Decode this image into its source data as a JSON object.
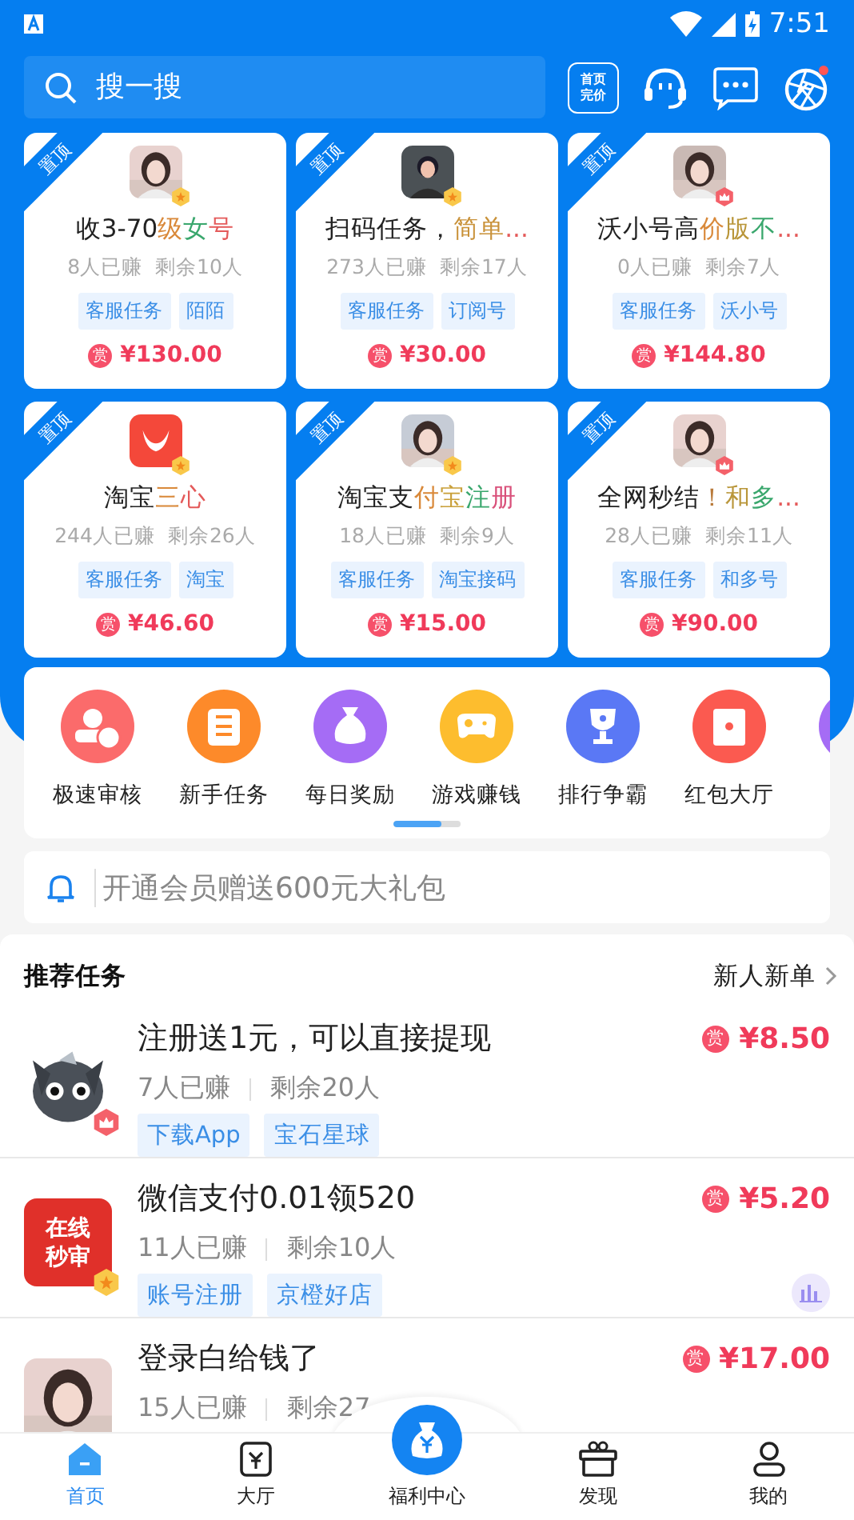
{
  "status_bar": {
    "time": "7:51"
  },
  "search": {
    "placeholder": "搜一搜"
  },
  "header_badge": [
    "首页",
    "完价"
  ],
  "cards": [
    {
      "pinned_label": "置顶",
      "title": [
        {
          "text": "收3-70"
        },
        {
          "text": "级",
          "color": "#d9893a"
        },
        {
          "text": "女",
          "color": "#3aa76d"
        },
        {
          "text": "号",
          "color": "#e45a5a"
        }
      ],
      "earned": "8人已赚",
      "remaining": "剩余10人",
      "tags": [
        "客服任务",
        "陌陌"
      ],
      "reward_mark": "赏",
      "price": "¥130.00"
    },
    {
      "pinned_label": "置顶",
      "title": [
        {
          "text": "扫码任务，"
        },
        {
          "text": "简单",
          "color": "#c9923a"
        },
        {
          "text": "...",
          "color": "#e45a5a"
        }
      ],
      "earned": "273人已赚",
      "remaining": "剩余17人",
      "tags": [
        "客服任务",
        "订阅号"
      ],
      "reward_mark": "赏",
      "price": "¥30.00"
    },
    {
      "pinned_label": "置顶",
      "title": [
        {
          "text": "沃小号高"
        },
        {
          "text": "价",
          "color": "#d9893a"
        },
        {
          "text": "版",
          "color": "#b9963a"
        },
        {
          "text": "不",
          "color": "#3aa76d"
        },
        {
          "text": "...",
          "color": "#e45a5a"
        }
      ],
      "earned": "0人已赚",
      "remaining": "剩余7人",
      "tags": [
        "客服任务",
        "沃小号"
      ],
      "reward_mark": "赏",
      "price": "¥144.80"
    },
    {
      "pinned_label": "置顶",
      "title": [
        {
          "text": "淘宝"
        },
        {
          "text": "三",
          "color": "#d9893a"
        },
        {
          "text": "心",
          "color": "#e45a5a"
        }
      ],
      "earned": "244人已赚",
      "remaining": "剩余26人",
      "tags": [
        "客服任务",
        "淘宝"
      ],
      "reward_mark": "赏",
      "price": "¥46.60"
    },
    {
      "pinned_label": "置顶",
      "title": [
        {
          "text": "淘宝支"
        },
        {
          "text": "付",
          "color": "#d9893a"
        },
        {
          "text": "宝",
          "color": "#c9a03a"
        },
        {
          "text": "注",
          "color": "#3aa76d"
        },
        {
          "text": "册",
          "color": "#d9507a"
        }
      ],
      "earned": "18人已赚",
      "remaining": "剩余9人",
      "tags": [
        "客服任务",
        "淘宝接码"
      ],
      "reward_mark": "赏",
      "price": "¥15.00"
    },
    {
      "pinned_label": "置顶",
      "title": [
        {
          "text": "全网秒结"
        },
        {
          "text": "！",
          "color": "#b97a3a"
        },
        {
          "text": "和",
          "color": "#b9963a"
        },
        {
          "text": "多",
          "color": "#3aa76d"
        },
        {
          "text": "...",
          "color": "#e45a5a"
        }
      ],
      "earned": "28人已赚",
      "remaining": "剩余11人",
      "tags": [
        "客服任务",
        "和多号"
      ],
      "reward_mark": "赏",
      "price": "¥90.00"
    }
  ],
  "shortcuts": [
    {
      "label": "极速审核",
      "color": "#fb6b6b"
    },
    {
      "label": "新手任务",
      "color": "#fd8a2a"
    },
    {
      "label": "每日奖励",
      "color": "#a56cf5"
    },
    {
      "label": "游戏赚钱",
      "color": "#fdbd2e"
    },
    {
      "label": "排行争霸",
      "color": "#5a78f5"
    },
    {
      "label": "红包大厅",
      "color": "#fb5a50"
    },
    {
      "color": "#a56cf5"
    }
  ],
  "notice": "开通会员赠送600元大礼包",
  "recommended": {
    "title": "推荐任务",
    "link": "新人新单"
  },
  "tasks": [
    {
      "title": "注册送1元，可以直接提现",
      "earned": "7人已赚",
      "remaining": "剩余20人",
      "tags": [
        "下载App",
        "宝石星球"
      ],
      "reward_mark": "赏",
      "price": "¥8.50"
    },
    {
      "title": "微信支付0.01领520",
      "avatar_text": [
        "在线",
        "秒审"
      ],
      "earned": "11人已赚",
      "remaining": "剩余10人",
      "tags": [
        "账号注册",
        "京橙好店"
      ],
      "reward_mark": "赏",
      "price": "¥5.20",
      "stats_button": true
    },
    {
      "title": "登录白给钱了",
      "earned": "15人已赚",
      "remaining": "剩余27",
      "reward_mark": "赏",
      "price": "¥17.00"
    }
  ],
  "nav": [
    {
      "label": "首页",
      "kind": "tab",
      "selected": true
    },
    {
      "label": "大厅",
      "kind": "tab",
      "selected": false
    },
    {
      "label": "福利中心",
      "kind": "center",
      "selected": false
    },
    {
      "label": "发现",
      "kind": "tab",
      "selected": false
    },
    {
      "label": "我的",
      "kind": "tab",
      "selected": false
    }
  ]
}
